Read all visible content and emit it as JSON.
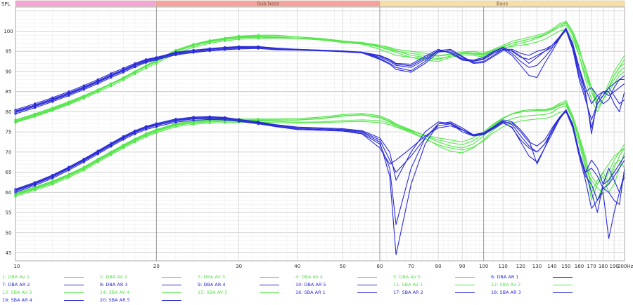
{
  "chart_data": {
    "type": "line",
    "ylabel": "SPL",
    "x_unit_label": "200Hz",
    "x_scale": "log",
    "xlim": [
      10,
      200
    ],
    "ylim": [
      43,
      106
    ],
    "grid": true,
    "bands": [
      {
        "label": "",
        "from": 10,
        "to": 20,
        "color": "#f4a6d9"
      },
      {
        "label": "Sub bass",
        "from": 20,
        "to": 60,
        "color": "#f6a3a0"
      },
      {
        "label": "Bass",
        "from": 60,
        "to": 200,
        "color": "#f7dfa6"
      }
    ],
    "x_ticks": [
      "10",
      "20",
      "30",
      "40",
      "50",
      "60",
      "70",
      "80",
      "90",
      "100",
      "110",
      "120",
      "130",
      "140",
      "150",
      "160",
      "170",
      "180",
      "190"
    ],
    "x_tick_values": [
      10,
      20,
      30,
      40,
      50,
      60,
      70,
      80,
      90,
      100,
      110,
      120,
      130,
      140,
      150,
      160,
      170,
      180,
      190
    ],
    "y_ticks": [
      "45",
      "50",
      "55",
      "60",
      "65",
      "70",
      "75",
      "80",
      "85",
      "90",
      "95",
      "100"
    ],
    "y_tick_values": [
      45,
      50,
      55,
      60,
      65,
      70,
      75,
      80,
      85,
      90,
      95,
      100
    ],
    "x": [
      10,
      11,
      12,
      13,
      14,
      15,
      16,
      17,
      18,
      19,
      20,
      22,
      24,
      26,
      28,
      30,
      33,
      36,
      40,
      45,
      50,
      55,
      60,
      63,
      65,
      70,
      75,
      80,
      85,
      90,
      95,
      100,
      105,
      110,
      115,
      120,
      125,
      130,
      135,
      140,
      145,
      150,
      155,
      160,
      165,
      170,
      175,
      180,
      185,
      190,
      195,
      200
    ],
    "series": [
      {
        "name": "1: DBA AV 1",
        "color": "#55e64a",
        "values": [
          77.5,
          79,
          80.5,
          82,
          83.6,
          85.2,
          86.8,
          88.2,
          89.8,
          91.3,
          92.5,
          95,
          96.5,
          97.4,
          98,
          98.5,
          98.6,
          98.5,
          98.3,
          97.8,
          97.2,
          96.8,
          96.5,
          96,
          95.5,
          95,
          94.5,
          94,
          94.3,
          94.8,
          95,
          94.5,
          95.5,
          96.5,
          97.5,
          98,
          98.5,
          99,
          99.5,
          100.5,
          101.8,
          102.5,
          100,
          96,
          90,
          86,
          83,
          84,
          87,
          90,
          92,
          94
        ]
      },
      {
        "name": "2: DBA AV 2",
        "color": "#55e64a",
        "values": [
          77.8,
          79.3,
          80.8,
          82.3,
          83.9,
          85.5,
          87,
          88.5,
          90,
          91.5,
          92.7,
          95.2,
          96.7,
          97.6,
          98.1,
          98.6,
          98.8,
          98.8,
          98.6,
          98.2,
          97.6,
          97.2,
          96.5,
          95.8,
          95.2,
          94,
          93.5,
          93.2,
          93.8,
          94.5,
          94.3,
          94,
          95,
          96,
          97,
          97.5,
          98,
          98.5,
          99,
          100,
          101,
          101.5,
          99,
          94,
          88,
          83,
          80,
          83,
          86,
          88,
          90,
          91
        ]
      },
      {
        "name": "3: DBA AV 3",
        "color": "#55e64a",
        "values": [
          78,
          79.5,
          81,
          82.5,
          84,
          85.5,
          87,
          88.5,
          90,
          91.5,
          92.8,
          95.3,
          96.8,
          97.7,
          98.3,
          98.8,
          99,
          99,
          98.6,
          98,
          97.5,
          97,
          96,
          95.3,
          94.7,
          93.5,
          92.8,
          92.5,
          93.5,
          94.2,
          94,
          93.6,
          94.5,
          95.5,
          96.5,
          97,
          97.5,
          98.2,
          99,
          100,
          101,
          102,
          99.5,
          95,
          91,
          86,
          82,
          83,
          85,
          87,
          89,
          90
        ]
      },
      {
        "name": "4: DBA AV 4",
        "color": "#55e64a",
        "values": [
          77.3,
          78.8,
          80.3,
          81.8,
          83.3,
          84.9,
          86.4,
          87.9,
          89.4,
          90.8,
          92,
          94.5,
          96,
          97,
          97.6,
          98,
          98.2,
          98.3,
          98.2,
          97.8,
          97.3,
          96.8,
          95.5,
          94.6,
          94,
          93.5,
          93.2,
          93,
          93.8,
          94.5,
          94.4,
          94.2,
          95,
          95.8,
          96.2,
          96.5,
          96.8,
          97.3,
          98,
          99,
          100,
          100.5,
          98,
          94,
          89,
          85,
          82,
          84,
          86,
          89,
          91,
          92
        ]
      },
      {
        "name": "5: DBA AV 5",
        "color": "#55e64a",
        "values": [
          77.6,
          79.1,
          80.6,
          82.1,
          83.7,
          85.3,
          86.8,
          88.3,
          89.8,
          91.2,
          92.4,
          94.9,
          96.4,
          97.3,
          97.9,
          98.3,
          98.5,
          98.4,
          98.3,
          98,
          97.5,
          97,
          96.2,
          95.5,
          95,
          94.5,
          94,
          93.8,
          94.2,
          94.8,
          94.6,
          94.3,
          95.3,
          96.2,
          97,
          97.5,
          98,
          98.6,
          99.2,
          100.2,
          101.4,
          102.2,
          99.5,
          95.5,
          90,
          85,
          81,
          83,
          86,
          89,
          91,
          93
        ]
      },
      {
        "name": "6: DBA AR 1",
        "color": "#2a2bd6",
        "values": [
          80.5,
          82,
          83.5,
          85,
          86.5,
          88,
          89.5,
          90.8,
          92,
          93,
          93.5,
          94.8,
          95.3,
          95.7,
          96,
          96.2,
          96.2,
          95.8,
          95.5,
          95.3,
          95,
          94.8,
          94,
          93,
          92,
          91.8,
          93.8,
          95.5,
          94.5,
          92.8,
          92.5,
          93,
          94.5,
          95.5,
          94,
          91.5,
          89,
          88.5,
          92,
          95,
          98,
          100.5,
          97,
          91,
          85,
          86,
          84,
          82,
          83,
          86,
          88,
          89
        ]
      },
      {
        "name": "7: DBA AR 2",
        "color": "#2a2bd6",
        "values": [
          80,
          81.5,
          83,
          84.5,
          86,
          87.5,
          89,
          90.3,
          91.6,
          92.6,
          93.3,
          94.5,
          95.1,
          95.5,
          95.8,
          96,
          96,
          95.6,
          95.4,
          95.2,
          95,
          94.7,
          93.5,
          92.5,
          91.5,
          91,
          93,
          95,
          94.8,
          93.2,
          92.8,
          93.5,
          95,
          96,
          95,
          93.5,
          93,
          94,
          95,
          96,
          98,
          100.5,
          96,
          89,
          84,
          76,
          82,
          84,
          86,
          84,
          82,
          83
        ]
      },
      {
        "name": "8: DBA AR 3",
        "color": "#2a2bd6",
        "values": [
          79.8,
          81.3,
          82.8,
          84.3,
          85.8,
          87.3,
          88.8,
          90.1,
          91.4,
          92.4,
          93.1,
          94.3,
          94.9,
          95.3,
          95.6,
          95.8,
          95.9,
          95.6,
          95.5,
          95.3,
          95.1,
          94.8,
          93.2,
          92,
          91,
          90.2,
          92.5,
          95.2,
          95.5,
          93.8,
          92.2,
          92.5,
          94,
          95.5,
          95.5,
          94.5,
          94,
          95,
          95.5,
          96.5,
          98.5,
          100.8,
          96.5,
          90,
          85,
          74.5,
          83,
          85,
          85,
          82,
          80,
          85
        ]
      },
      {
        "name": "9: DBA AR 4",
        "color": "#2a2bd6",
        "values": [
          79.5,
          81,
          82.5,
          84,
          85.5,
          87,
          88.5,
          89.8,
          91.1,
          92.2,
          92.9,
          94.1,
          94.7,
          95.1,
          95.4,
          95.6,
          95.7,
          95.4,
          95.3,
          95.1,
          94.9,
          94.6,
          93,
          91.8,
          90.5,
          89.8,
          92,
          94.8,
          95.2,
          93.6,
          92,
          92.2,
          93.7,
          95.2,
          95.2,
          93.8,
          92,
          93.5,
          95,
          96.5,
          98.2,
          100.2,
          95.5,
          88,
          83,
          78,
          82,
          84,
          86,
          87,
          88,
          88
        ]
      },
      {
        "name": "10: DBA AR 5",
        "color": "#2a2bd6",
        "values": [
          80.2,
          81.7,
          83.2,
          84.7,
          86.2,
          87.7,
          89.2,
          90.5,
          91.8,
          92.8,
          93.4,
          94.6,
          95.2,
          95.6,
          95.9,
          96.1,
          96.1,
          95.7,
          95.4,
          95.2,
          95,
          94.7,
          93.8,
          92.8,
          91.8,
          91.4,
          93.4,
          95.2,
          94.8,
          93,
          92.6,
          93.2,
          94.8,
          95.8,
          94.5,
          92.5,
          91,
          91.5,
          93.5,
          95.8,
          98.4,
          100.6,
          96.5,
          91,
          86,
          82,
          84,
          85,
          84,
          85,
          86,
          87
        ]
      },
      {
        "name": "11: SBA AV 1",
        "color": "#55e64a",
        "values": [
          59.5,
          61,
          62.5,
          64.2,
          66,
          68,
          69.8,
          71.5,
          73,
          74.3,
          75.3,
          76.8,
          77.4,
          77.7,
          77.8,
          77.9,
          77.9,
          77.9,
          77.9,
          78.3,
          78.9,
          79.2,
          78.5,
          77.5,
          76.5,
          75.2,
          74.2,
          73.5,
          73,
          72.5,
          73.5,
          75,
          77,
          78.5,
          79.5,
          80,
          80.2,
          80.3,
          80.3,
          80.5,
          81.5,
          82,
          78,
          73,
          68,
          62,
          58,
          62,
          65,
          68,
          70,
          72
        ]
      },
      {
        "name": "12: SBA AV 2",
        "color": "#55e64a",
        "values": [
          59.8,
          61.3,
          62.8,
          64.5,
          66.3,
          68.3,
          70.1,
          71.8,
          73.3,
          74.6,
          75.6,
          77.1,
          77.7,
          78,
          78.1,
          78.2,
          78.2,
          78.2,
          78.3,
          78.7,
          79.3,
          79.6,
          79,
          78,
          77,
          75.5,
          74,
          72.5,
          71.5,
          71,
          72,
          74,
          76.5,
          78.3,
          79.5,
          80.2,
          80.5,
          80.6,
          80.5,
          81,
          82,
          82.8,
          79,
          74,
          69,
          60,
          63,
          65,
          62,
          66,
          69,
          71
        ]
      },
      {
        "name": "13: SBA AV 3",
        "color": "#55e64a",
        "values": [
          59.3,
          60.8,
          62.3,
          64,
          65.8,
          67.8,
          69.6,
          71.3,
          72.8,
          74.1,
          75.1,
          76.6,
          77.2,
          77.5,
          77.6,
          77.7,
          77.7,
          77.6,
          77.4,
          77.5,
          77.8,
          78,
          77.8,
          77.2,
          76.5,
          75,
          73.5,
          71.5,
          70.2,
          69.8,
          71,
          73,
          75.5,
          77.3,
          78.3,
          78.8,
          79,
          79.2,
          79.3,
          79.8,
          81,
          81.5,
          78,
          73,
          67,
          58,
          62,
          64,
          60,
          62,
          66,
          70
        ]
      },
      {
        "name": "14: SBA AV 4",
        "color": "#55e64a",
        "values": [
          59,
          60.5,
          62,
          63.7,
          65.5,
          67.5,
          69.3,
          71,
          72.5,
          73.8,
          74.8,
          76.3,
          76.9,
          77.2,
          77.3,
          77.4,
          77.4,
          77.3,
          77.2,
          77.3,
          77.5,
          77.6,
          77.3,
          76.8,
          76.2,
          74.8,
          73.2,
          71.8,
          71,
          70.5,
          71.2,
          72.8,
          74.8,
          76.3,
          77.2,
          77.7,
          78,
          78.2,
          78.3,
          78.8,
          79.8,
          80.2,
          77,
          72,
          66,
          63,
          61,
          60,
          63,
          67,
          68,
          66
        ]
      },
      {
        "name": "15: SBA AV 5",
        "color": "#55e64a",
        "values": [
          59.6,
          61.1,
          62.6,
          64.3,
          66.1,
          68.1,
          69.9,
          71.6,
          73.1,
          74.4,
          75.4,
          76.9,
          77.5,
          77.8,
          77.9,
          78,
          78,
          78,
          78,
          78.4,
          79,
          79.3,
          78.7,
          77.7,
          76.8,
          75.3,
          74,
          73,
          72.3,
          71.8,
          72.8,
          74.6,
          76.8,
          78.4,
          79.4,
          79.9,
          80.2,
          80.4,
          80.4,
          80.7,
          81.7,
          82.3,
          78.5,
          73.5,
          68,
          64,
          62,
          65,
          67,
          69,
          70,
          71
        ]
      },
      {
        "name": "16: SBA AR 1",
        "color": "#2a2bd6",
        "values": [
          60.8,
          62.5,
          64.3,
          66.3,
          68.3,
          70.3,
          72.2,
          73.9,
          75.3,
          76.4,
          77.1,
          78.2,
          78.7,
          78.8,
          78.6,
          78.1,
          77.5,
          76.8,
          76.2,
          76,
          75.8,
          75.3,
          73.5,
          70,
          63,
          70,
          75,
          77.5,
          77,
          75,
          74,
          74.5,
          76,
          77.5,
          76,
          73,
          71,
          70,
          72,
          75,
          78,
          80.5,
          77,
          70,
          65,
          68,
          66,
          62,
          63,
          65,
          67,
          69
        ]
      },
      {
        "name": "17: SBA AR 2",
        "color": "#2a2bd6",
        "values": [
          60.5,
          62.2,
          64,
          66,
          68,
          70,
          71.9,
          73.6,
          75,
          76.1,
          76.8,
          77.9,
          78.4,
          78.5,
          78.4,
          78,
          77.3,
          76.5,
          75.8,
          75.6,
          75.4,
          74.9,
          72.5,
          64,
          44.5,
          62,
          72,
          77,
          77.5,
          76,
          74.3,
          74.8,
          76.3,
          78,
          77.5,
          75.5,
          73,
          67,
          71,
          75.5,
          78.5,
          80.5,
          76.5,
          69,
          65,
          60,
          55,
          62,
          66,
          63,
          60,
          65
        ]
      },
      {
        "name": "18: SBA AR 3",
        "color": "#2a2bd6",
        "values": [
          60.3,
          62,
          63.8,
          65.8,
          67.8,
          69.8,
          71.7,
          73.4,
          74.8,
          75.9,
          76.6,
          77.7,
          78.2,
          78.3,
          78.2,
          77.8,
          77.1,
          76.4,
          75.6,
          75.4,
          75.3,
          74.6,
          72,
          66,
          52,
          66,
          73.5,
          76.5,
          77,
          75.5,
          74,
          74.3,
          75.8,
          77.2,
          76.2,
          72.5,
          69,
          67.5,
          71,
          74.5,
          78,
          80.3,
          76,
          69,
          63,
          56,
          58,
          61,
          60,
          58,
          57,
          66
        ]
      },
      {
        "name": "19: SBA AR 4",
        "color": "#2a2bd6",
        "values": [
          60,
          61.7,
          63.5,
          65.5,
          67.5,
          69.5,
          71.4,
          73.1,
          74.5,
          75.6,
          76.3,
          77.4,
          77.9,
          78.1,
          78,
          77.6,
          77,
          76.3,
          75.6,
          75.4,
          75.2,
          74.5,
          71,
          67,
          68,
          71,
          74,
          76,
          76.5,
          75.5,
          74.3,
          74.6,
          76,
          77.5,
          77.2,
          75,
          72.5,
          71.5,
          73,
          76,
          78.5,
          80,
          76,
          70,
          64,
          62,
          58,
          60,
          48.5,
          55,
          60,
          64
        ]
      },
      {
        "name": "20: SBA AR 5",
        "color": "#2a2bd6",
        "values": [
          60.6,
          62.3,
          64.1,
          66.1,
          68.1,
          70.1,
          72,
          73.7,
          75.1,
          76.2,
          76.9,
          78,
          78.5,
          78.6,
          78.5,
          78.1,
          77.4,
          76.7,
          76,
          75.8,
          75.6,
          75.1,
          73,
          68,
          65,
          69,
          73.5,
          77,
          77.2,
          75.6,
          74.2,
          74.6,
          76.1,
          77.7,
          76.8,
          74,
          71.5,
          70,
          72,
          75.5,
          78.2,
          80.4,
          76.5,
          70,
          65,
          66,
          64,
          61,
          62,
          64,
          66,
          68
        ]
      }
    ]
  }
}
